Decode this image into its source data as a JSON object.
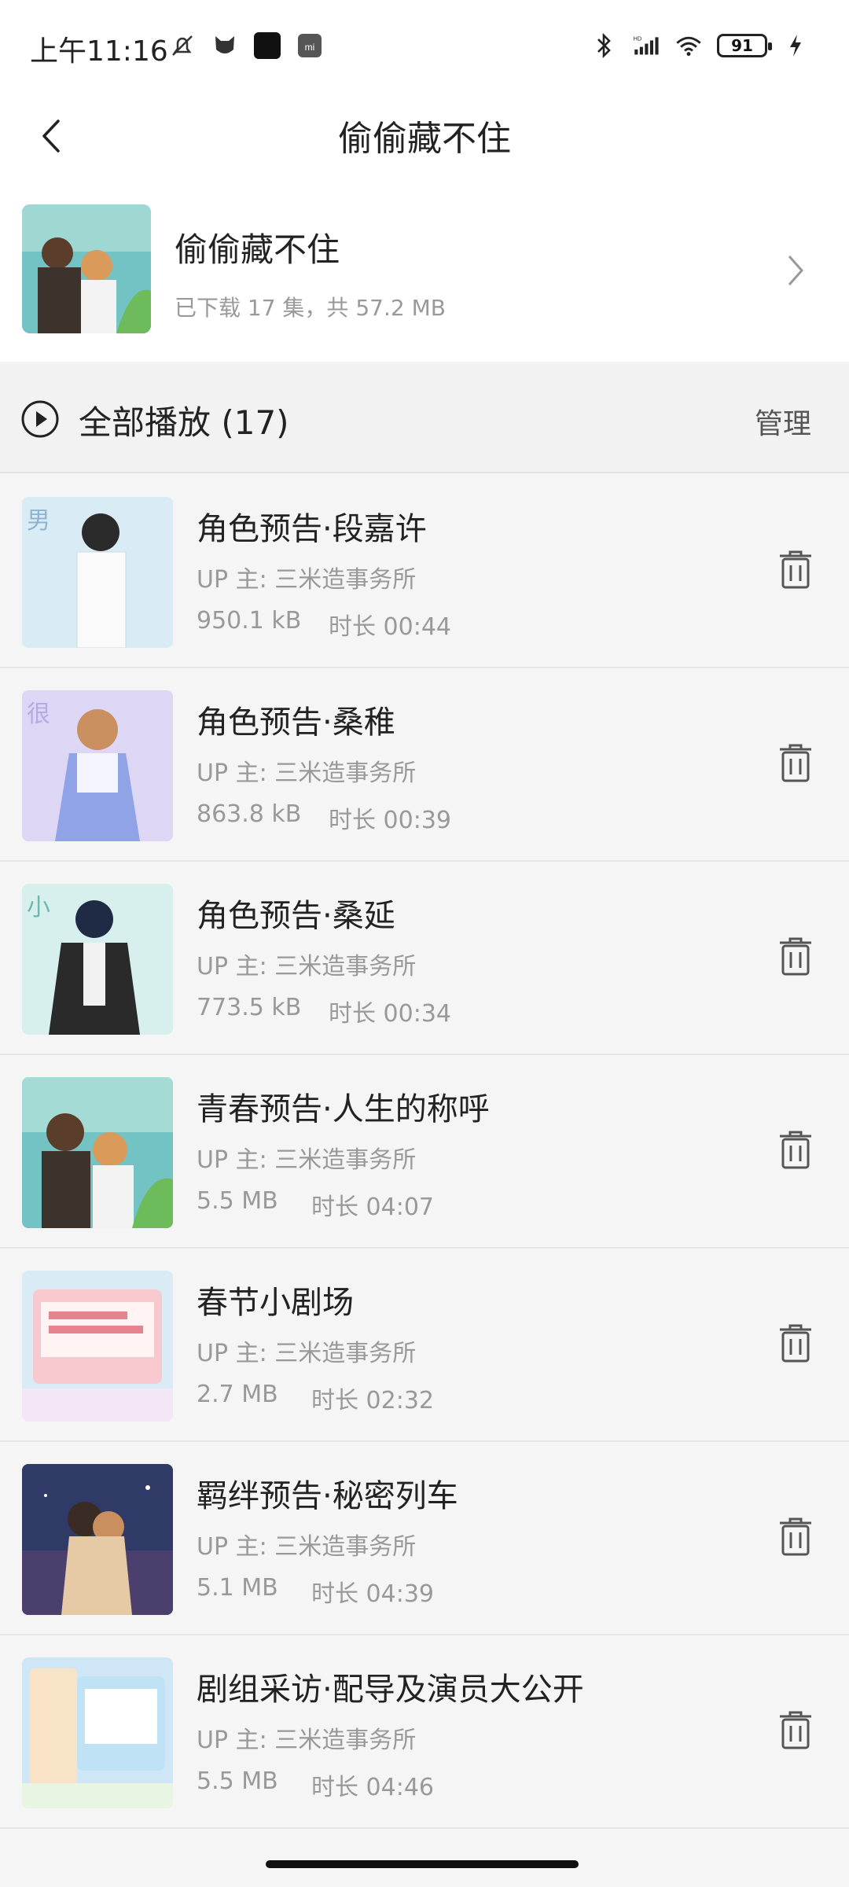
{
  "status": {
    "time": "上午11:16",
    "battery": "91"
  },
  "header": {
    "title": "偷偷藏不住"
  },
  "album": {
    "title": "偷偷藏不住",
    "subtitle": "已下载 17 集，共 57.2 MB"
  },
  "toolbar": {
    "play_all_label": "全部播放 (17)",
    "manage_label": "管理"
  },
  "episodes": [
    {
      "title": "角色预告·段嘉许",
      "up": "UP 主: 三米造事务所",
      "size": "950.1 kB",
      "duration": "时长 00:44",
      "thumb_colors": [
        "#d9ecf6",
        "#f6f8fb"
      ]
    },
    {
      "title": "角色预告·桑稚",
      "up": "UP 主: 三米造事务所",
      "size": "863.8 kB",
      "duration": "时长 00:39",
      "thumb_colors": [
        "#d8d3f2",
        "#eeeaff"
      ]
    },
    {
      "title": "角色预告·桑延",
      "up": "UP 主: 三米造事务所",
      "size": "773.5 kB",
      "duration": "时长 00:34",
      "thumb_colors": [
        "#d7f0ee",
        "#eefaf8"
      ]
    },
    {
      "title": "青春预告·人生的称呼",
      "up": "UP 主: 三米造事务所",
      "size": "5.5 MB",
      "duration": "时长 04:07",
      "thumb_colors": [
        "#6fbcc0",
        "#b8e3da"
      ]
    },
    {
      "title": "春节小剧场",
      "up": "UP 主: 三米造事务所",
      "size": "2.7 MB",
      "duration": "时长 02:32",
      "thumb_colors": [
        "#f7c9cf",
        "#d9ecf6"
      ]
    },
    {
      "title": "羁绊预告·秘密列车",
      "up": "UP 主: 三米造事务所",
      "size": "5.1 MB",
      "duration": "时长 04:39",
      "thumb_colors": [
        "#2f3a66",
        "#6b5fa2"
      ]
    },
    {
      "title": "剧组采访·配导及演员大公开",
      "up": "UP 主: 三米造事务所",
      "size": "5.5 MB",
      "duration": "时长 04:46",
      "thumb_colors": [
        "#cfe6f7",
        "#f8e3c7"
      ]
    }
  ],
  "colors": {
    "background": "#f5f5f5",
    "card": "#ffffff",
    "primary_text": "#222222",
    "secondary_text": "#999999"
  }
}
